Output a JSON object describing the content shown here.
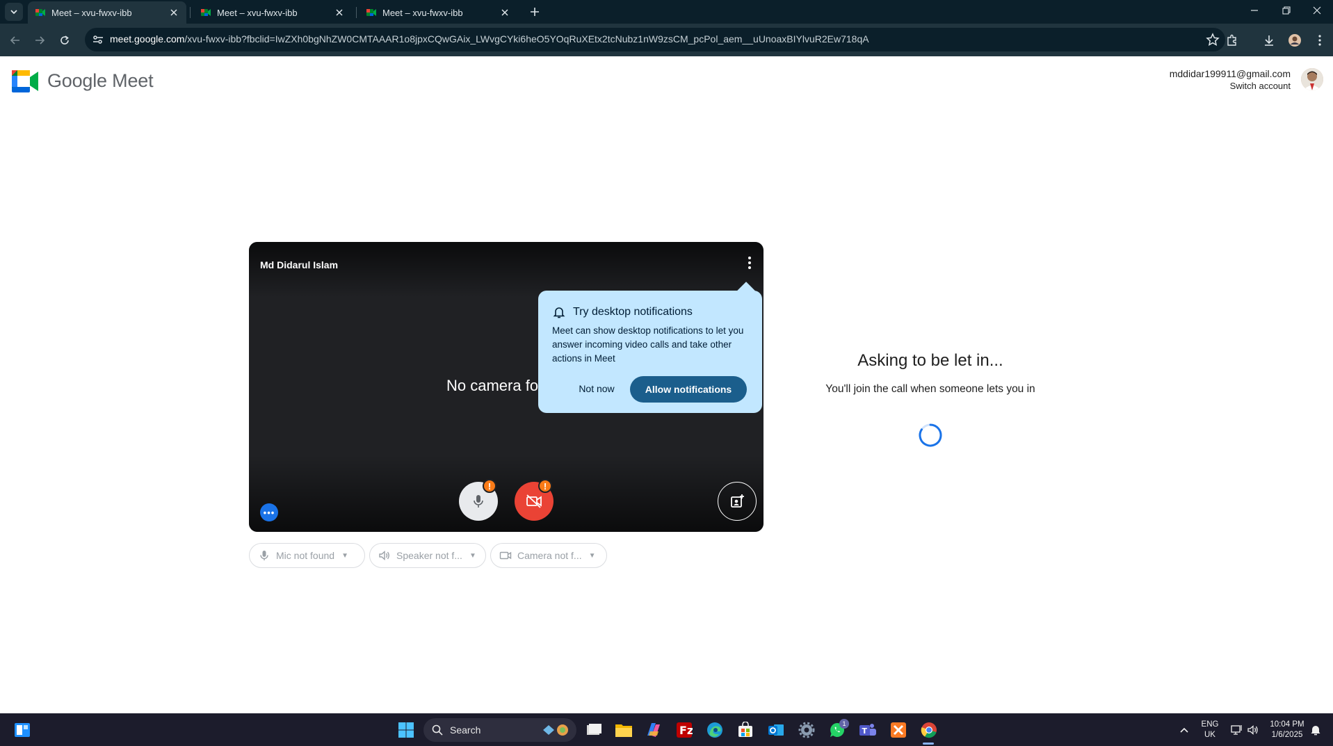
{
  "browser": {
    "tabs": [
      {
        "title": "Meet – xvu-fwxv-ibb",
        "active": true
      },
      {
        "title": "Meet – xvu-fwxv-ibb",
        "active": false
      },
      {
        "title": "Meet – xvu-fwxv-ibb",
        "active": false
      }
    ],
    "url_host": "meet.google.com",
    "url_rest": "/xvu-fwxv-ibb?fbclid=IwZXh0bgNhZW0CMTAAAR1o8jpxCQwGAix_LWvgCYki6heO5YOqRuXEtx2tcNubz1nW9zsCM_pcPol_aem__uUnoaxBIYlvuR2Ew718qA"
  },
  "header": {
    "brand": "Google Meet",
    "email": "mddidar199911@gmail.com",
    "switch_account": "Switch account"
  },
  "preview": {
    "self_name": "Md Didarul Islam",
    "no_camera": "No camera fo",
    "mic_warning": "!",
    "cam_warning": "!",
    "dots": "•••"
  },
  "popover": {
    "title": "Try desktop notifications",
    "body": "Meet can show desktop notifications to let you answer incoming video calls and take other actions in Meet",
    "not_now": "Not now",
    "allow": "Allow notifications"
  },
  "devices": {
    "mic": "Mic not found",
    "speaker": "Speaker not f...",
    "camera": "Camera not f..."
  },
  "status": {
    "asking": "Asking to be let in...",
    "join_note": "You'll join the call when someone lets you in"
  },
  "taskbar": {
    "search": "Search",
    "lang": "ENG",
    "region": "UK",
    "time": "10:04 PM",
    "date": "1/6/2025",
    "whatsapp_badge": "1"
  },
  "colors": {
    "chrome_dark": "#0b1f2a",
    "chrome_toolbar": "#20343e",
    "popover_bg": "#c2e7ff",
    "allow_btn": "#1b5e8c",
    "cam_off_red": "#ea4335",
    "warning_orange": "#fa7b17"
  }
}
